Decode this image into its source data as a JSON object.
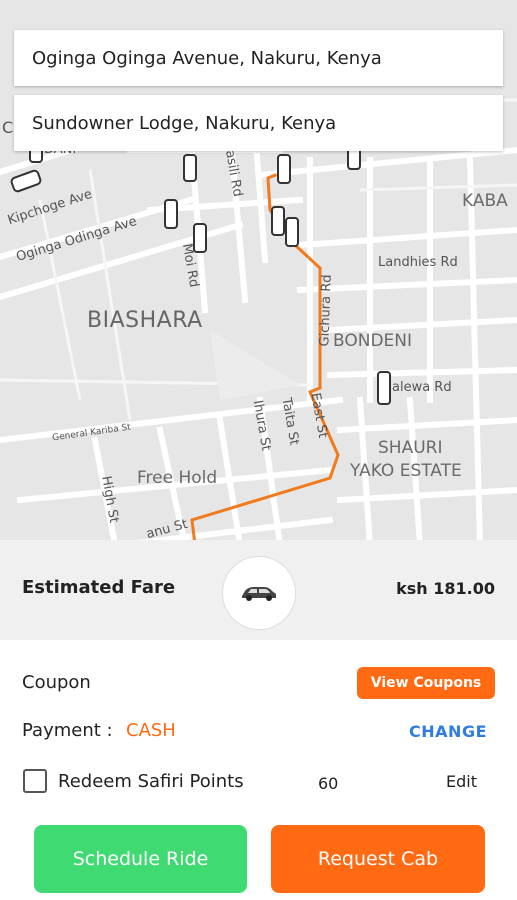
{
  "route": {
    "pickup": "Oginga Oginga Avenue, Nakuru, Kenya",
    "dropoff": "Sundowner Lodge, Nakuru, Kenya"
  },
  "map": {
    "labels": {
      "kipchoge": "Kipchoge Ave",
      "oginga": "Oginga Odinga Ave",
      "moi": "Moi Rd",
      "kabiru": "asili Rd",
      "biashara": "BIASHARA",
      "gichura": "Gichura Rd",
      "landhies": "Landhies Rd",
      "bondeni": "BONDENI",
      "kaba": "KABA",
      "kalewa": "alewa Rd",
      "kariba": "General Kariba St",
      "ihura": "Ihura St",
      "taita": "Taita St",
      "east": "East St",
      "shauri": "SHAURI",
      "yako": "YAKO ESTATE",
      "freehold": "Free Hold",
      "high": "High St",
      "kenyatta": "anu St",
      "gate": "DANI",
      "c": "C"
    },
    "route_color": "#f07a1c",
    "pin_color": "#3a7bd5"
  },
  "fare": {
    "label": "Estimated Fare",
    "value": "ksh 181.00",
    "vehicle_icon": "car-icon"
  },
  "coupon": {
    "label": "Coupon",
    "button": "View Coupons"
  },
  "payment": {
    "label": "Payment :",
    "method": "CASH",
    "change": "CHANGE"
  },
  "redeem": {
    "label": "Redeem Safiri Points",
    "points": "60",
    "edit": "Edit",
    "checked": false
  },
  "actions": {
    "schedule": "Schedule Ride",
    "request": "Request Cab"
  },
  "colors": {
    "accent": "#ff6a13",
    "schedule": "#3fdb72",
    "link": "#2f7de1"
  }
}
